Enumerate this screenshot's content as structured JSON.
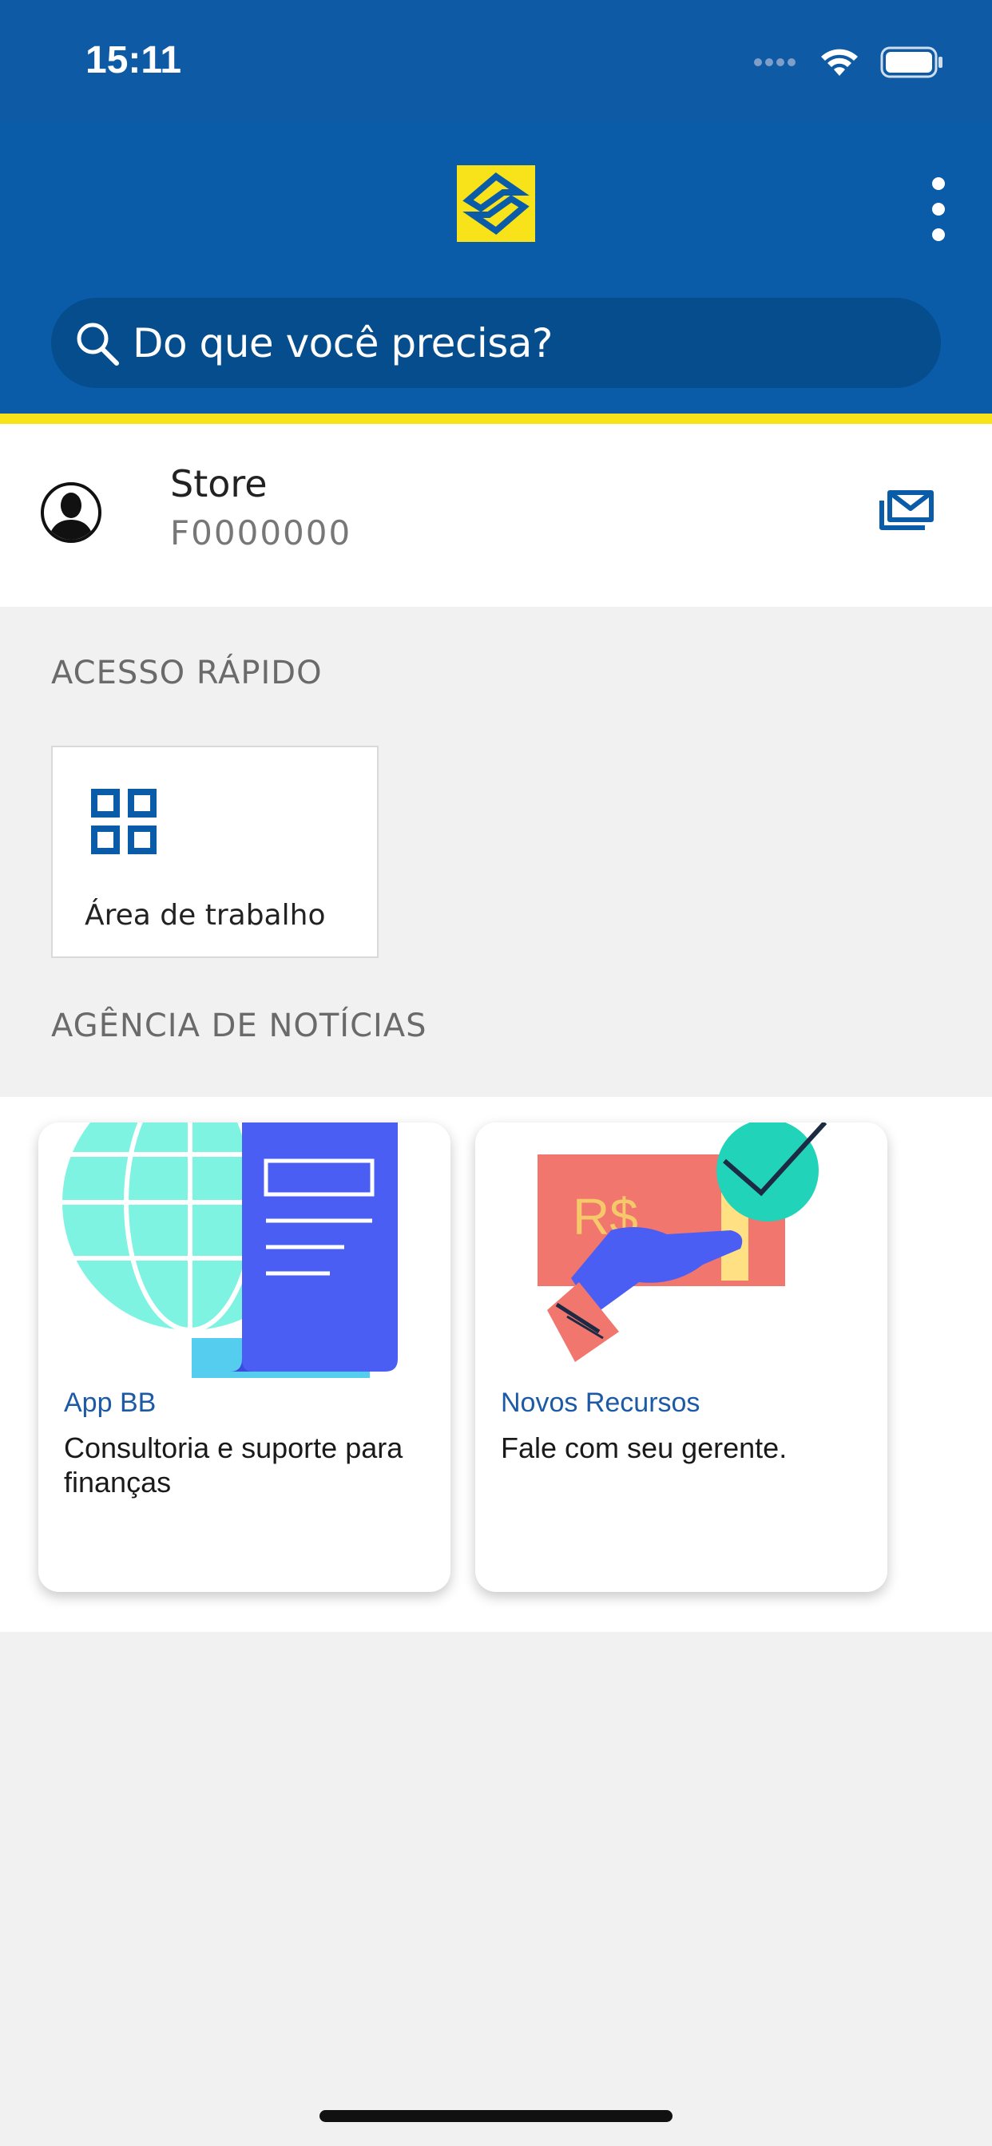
{
  "status_bar": {
    "time": "15:11"
  },
  "header": {
    "search_placeholder": "Do que você precisa?",
    "logo_icon": "banco-do-brasil-logo",
    "menu_icon": "more-vertical-icon",
    "colors": {
      "primary": "#0a5ca8",
      "accent": "#f8e21a"
    }
  },
  "profile": {
    "name": "Store",
    "id": "F0000000",
    "mail_icon": "mail-icon"
  },
  "quick_access": {
    "title": "ACESSO RÁPIDO",
    "items": [
      {
        "label": "Área de trabalho",
        "icon": "grid-icon"
      }
    ]
  },
  "news": {
    "title": "AGÊNCIA DE NOTÍCIAS",
    "items": [
      {
        "tag": "App BB",
        "title": "Consultoria e suporte para finanças"
      },
      {
        "tag": "Novos Recursos",
        "title": "Fale com seu gerente."
      }
    ]
  }
}
